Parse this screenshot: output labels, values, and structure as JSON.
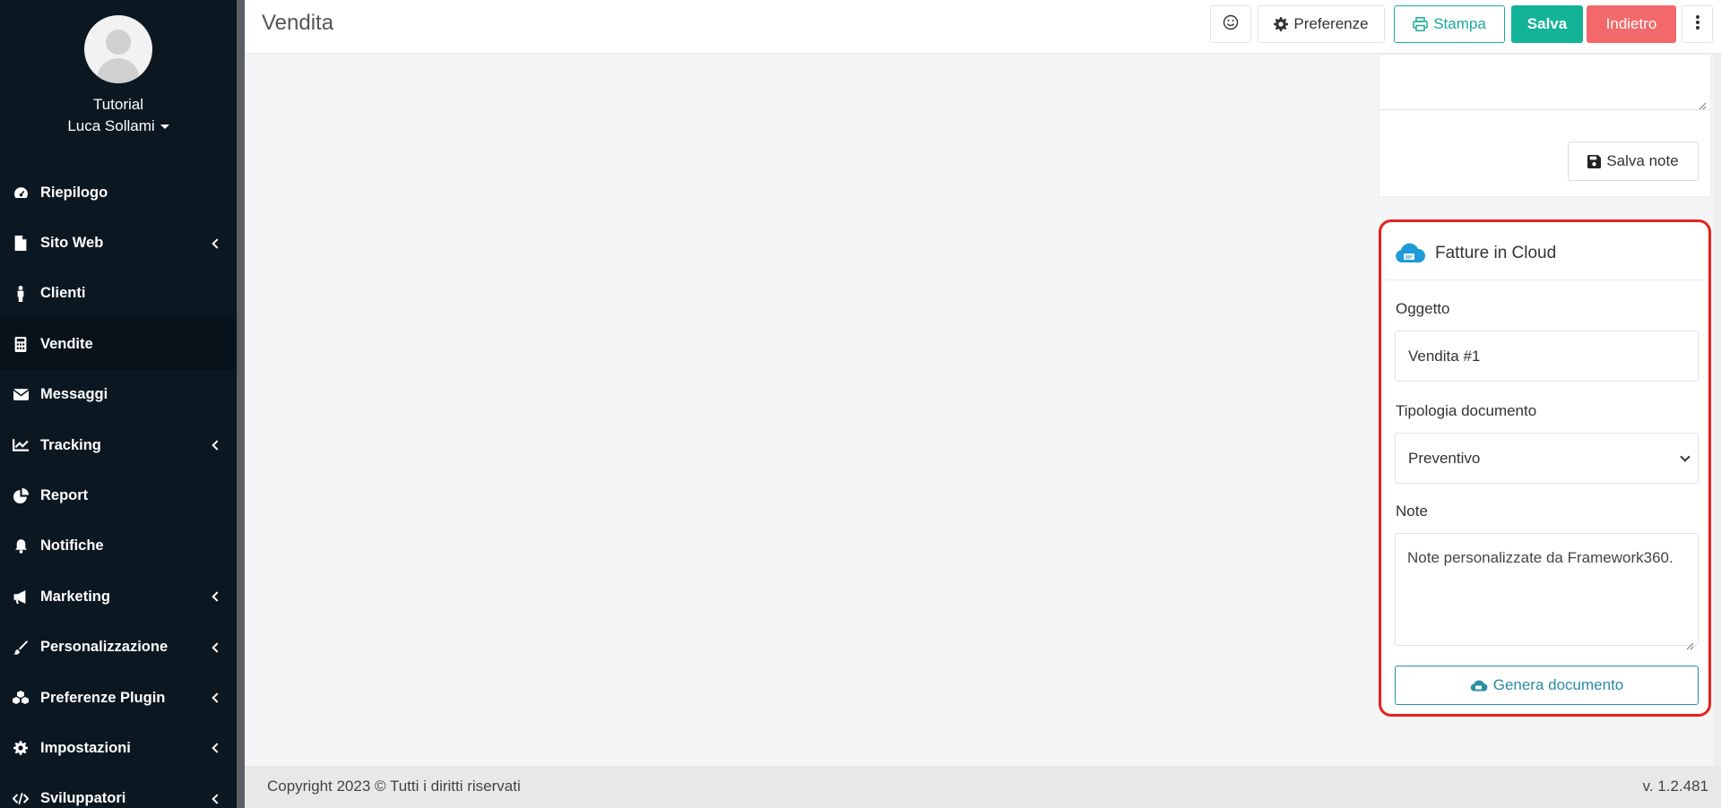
{
  "sidebar": {
    "org": "Tutorial",
    "user": "Luca Sollami",
    "items": [
      {
        "label": "Riepilogo",
        "icon": "dashboard-icon",
        "has_children": false
      },
      {
        "label": "Sito Web",
        "icon": "file-icon",
        "has_children": true
      },
      {
        "label": "Clienti",
        "icon": "person-icon",
        "has_children": false
      },
      {
        "label": "Vendite",
        "icon": "calculator-icon",
        "has_children": false,
        "active": true
      },
      {
        "label": "Messaggi",
        "icon": "envelope-icon",
        "has_children": false
      },
      {
        "label": "Tracking",
        "icon": "line-chart-icon",
        "has_children": true
      },
      {
        "label": "Report",
        "icon": "pie-chart-icon",
        "has_children": false
      },
      {
        "label": "Notifiche",
        "icon": "bell-icon",
        "has_children": false
      },
      {
        "label": "Marketing",
        "icon": "megaphone-icon",
        "has_children": true
      },
      {
        "label": "Personalizzazione",
        "icon": "brush-icon",
        "has_children": true
      },
      {
        "label": "Preferenze Plugin",
        "icon": "cubes-icon",
        "has_children": true
      },
      {
        "label": "Impostazioni",
        "icon": "cog-icon",
        "has_children": true
      },
      {
        "label": "Sviluppatori",
        "icon": "code-icon",
        "has_children": true
      }
    ]
  },
  "header": {
    "title": "Vendita",
    "preferences_label": "Preferenze",
    "print_label": "Stampa",
    "save_label": "Salva",
    "back_label": "Indietro"
  },
  "notes_card": {
    "save_notes_label": "Salva note"
  },
  "fatture_card": {
    "title": "Fatture in Cloud",
    "subject_label": "Oggetto",
    "subject_value": "Vendita #1",
    "doc_type_label": "Tipologia documento",
    "doc_type_value": "Preventivo",
    "notes_label": "Note",
    "notes_value": "Note personalizzate da Framework360.",
    "generate_label": "Genera documento"
  },
  "footer": {
    "copyright": "Copyright 2023 © Tutti i diritti riservati",
    "version": "v. 1.2.481"
  },
  "colors": {
    "sidebar_bg": "#0b1721",
    "print_accent": "#1eaa9b",
    "save_green": "#12b396",
    "back_red": "#f3686a",
    "highlight_red": "#e8211a",
    "cloud_blue": "#2a90a6"
  }
}
